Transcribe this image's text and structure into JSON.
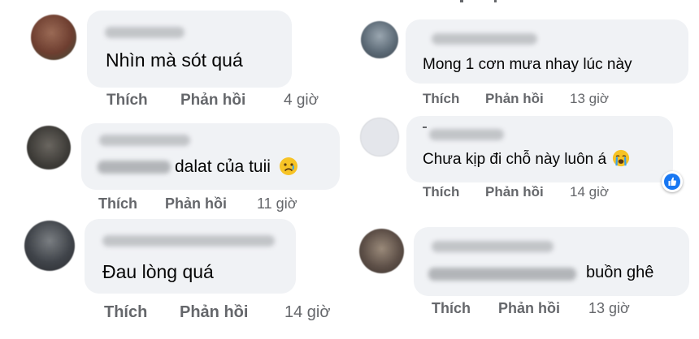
{
  "colors": {
    "bubble": "#f0f2f5",
    "text": "#050505",
    "secondary": "#65676b",
    "like_blue": "#1877f2"
  },
  "comments": [
    {
      "text": "Nhìn mà sót quá",
      "like": "Thích",
      "reply": "Phản hồi",
      "time": "4 giờ",
      "avatar_color": "#7a4a3a"
    },
    {
      "text": "dalat của tuii",
      "emoji": "sad-face-icon",
      "like": "Thích",
      "reply": "Phản hồi",
      "time": "11 giờ",
      "avatar_color": "#4a4a44"
    },
    {
      "text": "Đau lòng quá",
      "like": "Thích",
      "reply": "Phản hồi",
      "time": "14 giờ",
      "avatar_color": "#3c4046"
    },
    {
      "text": "Mong 1 cơn mưa nhay lúc này",
      "like": "Thích",
      "reply": "Phản hồi",
      "time": "13 giờ",
      "avatar_color": "#6c7a86"
    },
    {
      "text": "Chưa kịp đi chỗ này luôn á",
      "emoji": "crying-face-icon",
      "reaction": "like-reaction-icon",
      "like": "Thích",
      "reply": "Phản hồi",
      "time": "14 giờ",
      "avatar_color": "#e4e6eb"
    },
    {
      "text": "buồn ghê",
      "like": "Thích",
      "reply": "Phản hồi",
      "time": "13 giờ",
      "avatar_color": "#5a5048"
    }
  ]
}
